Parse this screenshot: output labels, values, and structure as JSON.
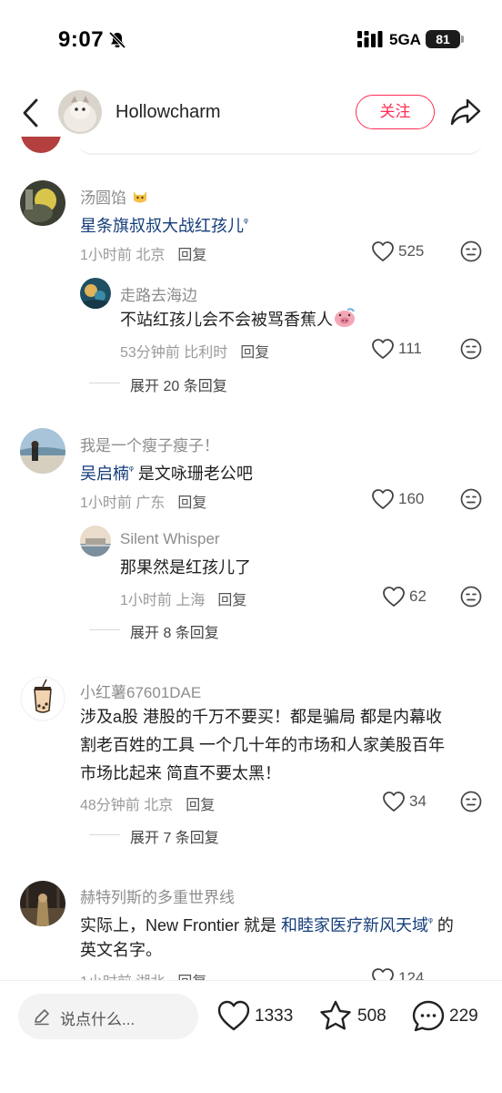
{
  "status_bar": {
    "time": "9:07",
    "network": "5GA",
    "battery": "81"
  },
  "header": {
    "username": "Hollowcharm",
    "follow_label": "关注"
  },
  "comments": [
    {
      "username": "汤圆馅",
      "text_link": "星条旗叔叔大战红孩儿",
      "text_after": "",
      "time": "1小时前",
      "location": "北京",
      "reply_label": "回复",
      "likes": "525",
      "reply": {
        "username": "走路去海边",
        "text": "不站红孩儿会不会被骂香蕉人",
        "time": "53分钟前",
        "location": "比利时",
        "reply_label": "回复",
        "likes": "111"
      },
      "expand": "展开 20 条回复"
    },
    {
      "username": "我是一个瘦子瘦子！",
      "text_link": "吴启楠",
      "text_after": " 是文咏珊老公吧",
      "time": "1小时前",
      "location": "广东",
      "reply_label": "回复",
      "likes": "160",
      "reply": {
        "username": "Silent Whisper",
        "text": "那果然是红孩儿了",
        "time": "1小时前",
        "location": "上海",
        "reply_label": "回复",
        "likes": "62"
      },
      "expand": "展开 8 条回复"
    },
    {
      "username": "小红薯67601DAE",
      "lines": [
        "涉及a股 港股的千万不要买！都是骗局 都是内幕收",
        "割老百姓的工具 一个几十年的市场和人家美股百年",
        "市场比起来 简直不要太黑！"
      ],
      "time": "48分钟前",
      "location": "北京",
      "reply_label": "回复",
      "likes": "34",
      "expand": "展开 7 条回复"
    },
    {
      "username": "赫特列斯的多重世界线",
      "text_before": "实际上，New Frontier 就是 ",
      "text_link": "和睦家医疗新风天域",
      "text_after": " 的",
      "line2": "英文名字。",
      "time": "1小时前",
      "location": "湖北",
      "reply_label": "回复",
      "likes": "124"
    }
  ],
  "bottom_bar": {
    "input_placeholder": "说点什么...",
    "likes": "1333",
    "stars": "508",
    "comments": "229"
  },
  "colors": {
    "accent": "#ff2d55",
    "link": "#143d7a",
    "meta": "#9a9a9a"
  },
  "icons": [
    "back-icon",
    "share-icon",
    "heart-icon",
    "face-icon",
    "star-icon",
    "comment-icon",
    "pencil-icon",
    "bell-mute-icon",
    "signal-icon"
  ]
}
